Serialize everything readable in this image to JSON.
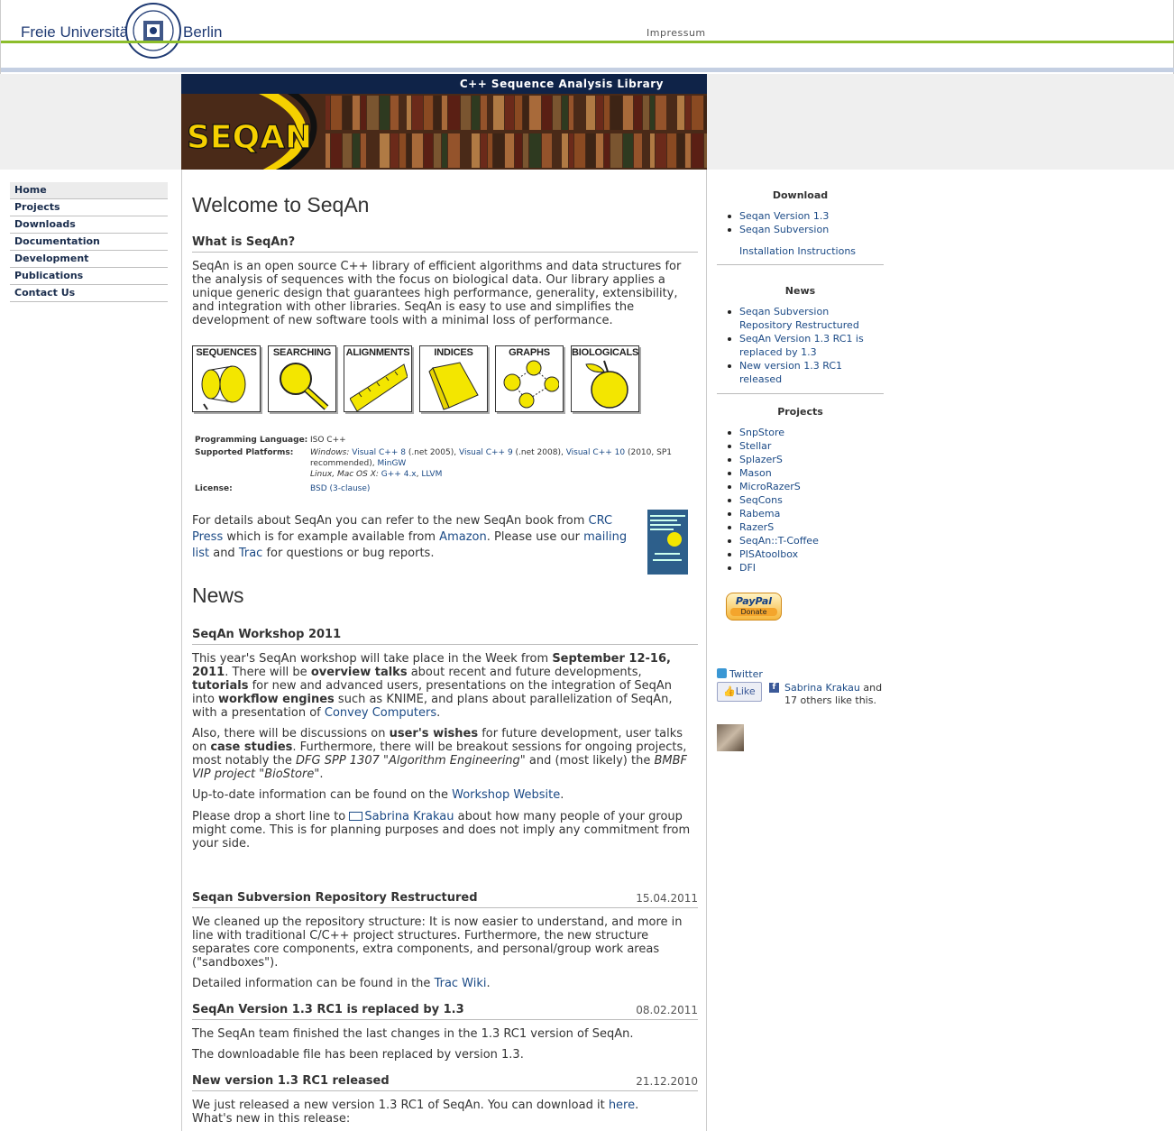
{
  "header": {
    "university_left": "Freie Universität",
    "university_right": "Berlin",
    "impressum": "Impressum"
  },
  "banner": {
    "title": "C++ Sequence Analysis Library",
    "logo_text": "SEQAN"
  },
  "leftnav": {
    "items": [
      {
        "label": "Home"
      },
      {
        "label": "Projects"
      },
      {
        "label": "Downloads"
      },
      {
        "label": "Documentation"
      },
      {
        "label": "Development"
      },
      {
        "label": "Publications"
      },
      {
        "label": "Contact Us"
      }
    ]
  },
  "main": {
    "title": "Welcome to SeqAn",
    "what_heading": "What is SeqAn?",
    "what_text": "SeqAn is an open source C++ library of efficient algorithms and data structures for the analysis of sequences with the focus on biological data. Our library applies a unique generic design that guarantees high performance, generality, extensibility, and integration with other libraries. SeqAn is easy to use and simplifies the development of new software tools with a minimal loss of performance.",
    "icons": [
      {
        "label": "SEQUENCES"
      },
      {
        "label": "SEARCHING"
      },
      {
        "label": "ALIGNMENTS"
      },
      {
        "label": "INDICES"
      },
      {
        "label": "GRAPHS"
      },
      {
        "label": "BIOLOGICALS"
      }
    ],
    "info": {
      "prog_lang_label": "Programming Language:",
      "prog_lang_value": "ISO C++",
      "platforms_label": "Supported Platforms:",
      "windows_prefix": "Windows:",
      "vc8": "Visual C++ 8",
      "vc8_suffix": " (.net 2005), ",
      "vc9": "Visual C++ 9",
      "vc9_suffix": " (.net 2008), ",
      "vc10": "Visual C++ 10",
      "vc10_suffix": " (2010, SP1 recommended), ",
      "mingw": "MinGW",
      "unix_prefix": "Linux, Mac OS X:",
      "gcc": "G++ 4.x",
      "llvm": "LLVM",
      "license_label": "License:",
      "license_value": "BSD (3-clause)"
    },
    "details": {
      "t1": "For details about SeqAn you can refer to the new SeqAn book from ",
      "crc": "CRC Press",
      "t2": " which is for example available from ",
      "amazon": "Amazon",
      "t3": ". Please use our ",
      "mailing": "mailing list",
      "t4": " and ",
      "trac": "Trac",
      "t5": " for questions or bug reports."
    },
    "news_title": "News",
    "news": {
      "ws_heading": "SeqAn Workshop 2011",
      "ws_p1_a": "This year's SeqAn workshop will take place in the Week from ",
      "ws_p1_b": "September 12-16, 2011",
      "ws_p1_c": ". There will be ",
      "ws_p1_d": "overview talks",
      "ws_p1_e": " about recent and future developments, ",
      "ws_p1_f": "tutorials",
      "ws_p1_g": " for new and advanced users, presentations on the integration of SeqAn into ",
      "ws_p1_h": "workflow engines",
      "ws_p1_i": " such as KNIME, and plans about parallelization of SeqAn, with a presentation of ",
      "ws_p1_j": "Convey Computers",
      "ws_p1_k": ".",
      "ws_p2_a": "Also, there will be discussions on ",
      "ws_p2_b": "user's wishes",
      "ws_p2_c": " for future development, user talks on ",
      "ws_p2_d": "case studies",
      "ws_p2_e": ". Furthermore, there will be breakout sessions for ongoing projects, most notably the ",
      "ws_p2_f": "DFG SPP 1307 \"Algorithm Engineering\"",
      "ws_p2_g": " and (most likely) the ",
      "ws_p2_h": "BMBF VIP project \"BioStore\"",
      "ws_p2_i": ".",
      "ws_p3_a": "Up-to-date information can be found on the ",
      "ws_p3_b": "Workshop Website",
      "ws_p3_c": ".",
      "ws_p4_a": "Please drop a short line to ",
      "ws_p4_b": "Sabrina Krakau",
      "ws_p4_c": " about how many people of your group might come. This is for planning purposes and does not imply any commitment from your side.",
      "svn_heading": "Seqan Subversion Repository Restructured",
      "svn_date": "15.04.2011",
      "svn_p1": "We cleaned up the repository structure: It is now easier to understand, and more in line with traditional C/C++ project structures. Furthermore, the new structure separates core components, extra components, and personal/group work areas (\"sandboxes\").",
      "svn_p2_a": "Detailed information can be found in the ",
      "svn_p2_b": "Trac Wiki",
      "svn_p2_c": ".",
      "v13_heading": "SeqAn Version 1.3 RC1 is replaced by 1.3",
      "v13_date": "08.02.2011",
      "v13_p1": "The SeqAn team finished the last changes in the 1.3 RC1 version of SeqAn.",
      "v13_p2": "The downloadable file has been replaced by version 1.3.",
      "rc1_heading": "New version 1.3 RC1 released",
      "rc1_date": "21.12.2010",
      "rc1_p1_a": "We just released a new version 1.3 RC1 of SeqAn. You can download it ",
      "rc1_p1_b": "here",
      "rc1_p1_c": ".",
      "rc1_p2": "What's new in this release:"
    }
  },
  "right": {
    "download_heading": "Download",
    "download_items": [
      "Seqan Version 1.3",
      "Seqan Subversion"
    ],
    "install_link": "Installation Instructions",
    "news_heading": "News",
    "news_items": [
      "Seqan Subversion Repository Restructured",
      "SeqAn Version 1.3 RC1 is replaced by 1.3",
      "New version 1.3 RC1 released"
    ],
    "projects_heading": "Projects",
    "projects": [
      "SnpStore",
      "Stellar",
      "SplazerS",
      "Mason",
      "MicroRazerS",
      "SeqCons",
      "Rabema",
      "RazerS",
      "SeqAn::T-Coffee",
      "PISAtoolbox",
      "DFI"
    ],
    "paypal_label": "PayPal",
    "donate_label": "Donate",
    "twitter": "Twitter",
    "like_button": "Like",
    "like_name": "Sabrina Krakau",
    "like_rest": " and 17 others like this."
  }
}
